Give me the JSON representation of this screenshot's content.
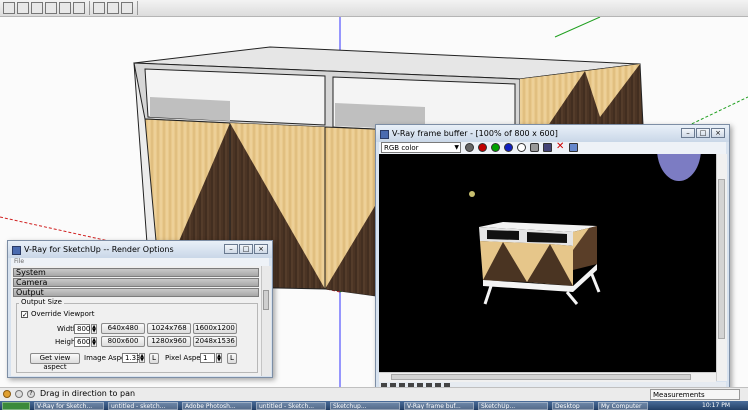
{
  "toolbar": {
    "icons": [
      "select-icon",
      "house-icon",
      "house-icon",
      "house-icon",
      "view-icon",
      "pan-icon",
      "orbit-icon",
      "zoom-icon"
    ]
  },
  "status": {
    "hint": "Drag in direction to pan",
    "measurements_label": "Measurements"
  },
  "vfb": {
    "title": "V-Ray frame buffer - [100% of 800 x 600]",
    "channel": "RGB color",
    "buttons": [
      {
        "name": "red-channel-button",
        "color": "#c00000"
      },
      {
        "name": "green-channel-button",
        "color": "#00a000"
      },
      {
        "name": "blue-channel-button",
        "color": "#1020c0"
      }
    ]
  },
  "render_options": {
    "title": "V-Ray for SketchUp -- Render Options",
    "menu": "File",
    "rollouts": [
      "System",
      "Camera",
      "Output"
    ],
    "group_title": "Output Size",
    "override_label": "Override Viewport",
    "override_checked": "✓",
    "width_label": "Width",
    "width_value": "800",
    "height_label": "Height",
    "height_value": "600",
    "presets": [
      "640x480",
      "1024x768",
      "1600x1200",
      "800x600",
      "1280x960",
      "2048x1536"
    ],
    "get_view_aspect": "Get view aspect",
    "image_aspect_label": "Image Aspect",
    "image_aspect_value": "1.333",
    "pixel_aspect_label": "Pixel Aspect",
    "pixel_aspect_value": "1",
    "lock_label": "L"
  },
  "taskbar": {
    "items": [
      "V-Ray for Sketch...",
      "untitled - sketch...",
      "Adobe Photosh...",
      "untitled - Sketch...",
      "Sketchup...",
      "V-Ray frame buf...",
      "SketchUp...",
      "Desktop",
      "My Computer"
    ],
    "time": "10:17 PM"
  },
  "colors": {
    "wood_light": "#e8c98a",
    "wood_dark": "#4a3422",
    "axis_blue": "#3030ff",
    "axis_red": "#d02020",
    "axis_green": "#20a020"
  }
}
